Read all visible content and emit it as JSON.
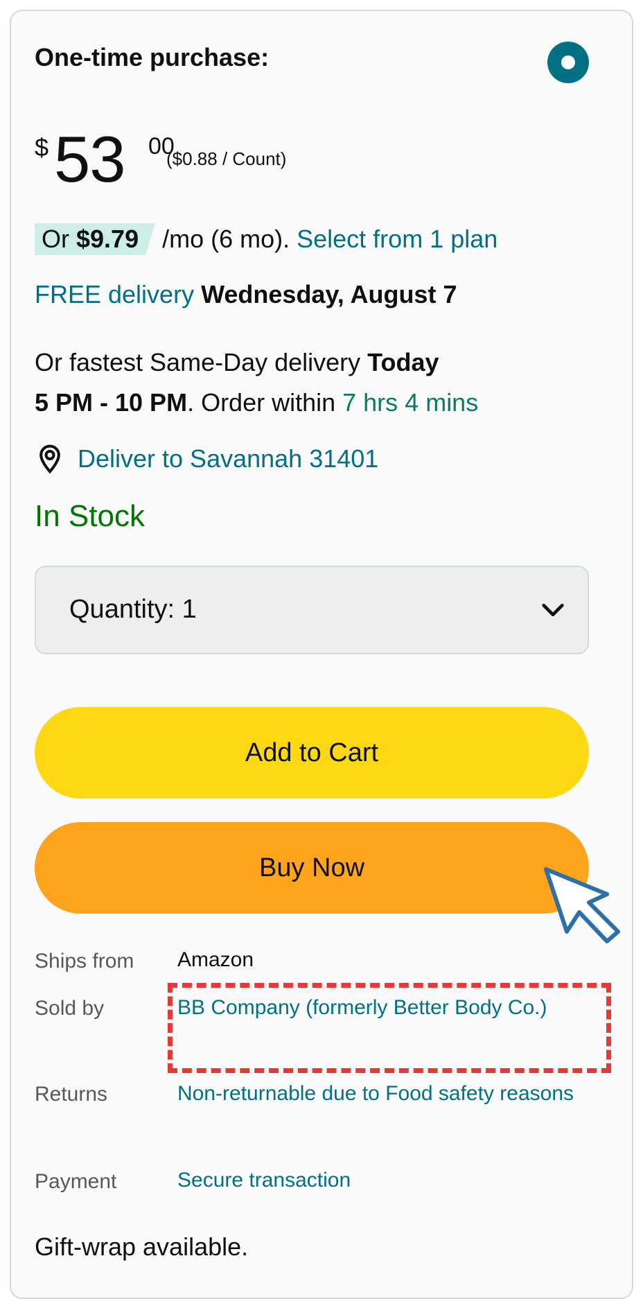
{
  "offer": {
    "title": "One-time purchase:",
    "price_symbol": "$",
    "price_whole": "53",
    "price_fraction": "00",
    "unit_price": "($0.88 / Count)",
    "plan_prefix": "Or ",
    "plan_amount": "$9.79",
    "plan_term": " /mo (6 mo). ",
    "plan_link": "Select from 1 plan"
  },
  "delivery": {
    "free_label": "FREE delivery",
    "free_date": " Wednesday, August 7",
    "fast_prefix": "Or fastest Same-Day delivery ",
    "fast_day": "Today",
    "fast_window": "5 PM - 10 PM",
    "fast_order_text": ". Order within ",
    "countdown": "7 hrs 4 mins",
    "deliver_to": "Deliver to Savannah 31401"
  },
  "stock_status": "In Stock",
  "quantity": {
    "label": "Quantity:",
    "value": "1"
  },
  "buttons": {
    "add_to_cart": "Add to Cart",
    "buy_now": "Buy Now"
  },
  "info": {
    "ships_from_label": "Ships from",
    "ships_from_value": "Amazon",
    "sold_by_label": "Sold by",
    "sold_by_value": "BB Company (formerly Better Body Co.)",
    "returns_label": "Returns",
    "returns_value": "Non-returnable due to Food safety reasons",
    "payment_label": "Payment",
    "payment_value": "Secure transaction"
  },
  "gift_wrap": "Gift-wrap available.",
  "colors": {
    "link": "#007185",
    "in_stock": "#007600",
    "countdown": "#067d62",
    "add_to_cart": "#ffd814",
    "buy_now": "#ffa41c",
    "plan_badge": "#cdeee7",
    "highlight": "#e53935"
  },
  "icons": {
    "radio": "radio-selected-icon",
    "location": "location-pin-icon",
    "dropdown": "chevron-down-icon",
    "cursor": "pointer-cursor-icon"
  }
}
